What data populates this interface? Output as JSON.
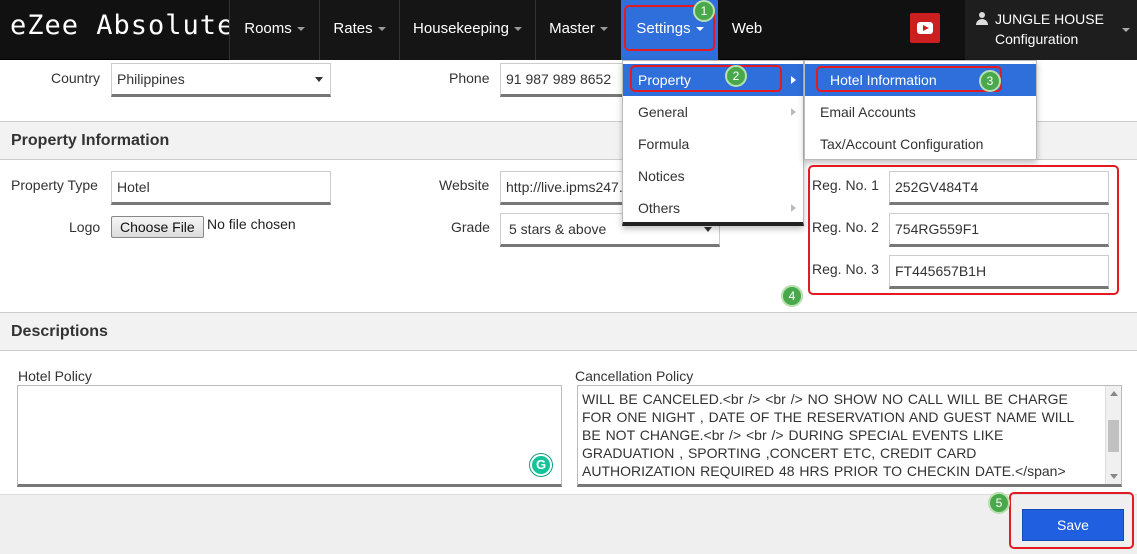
{
  "app": {
    "brand": "eZee Absolute"
  },
  "nav": {
    "rooms": "Rooms",
    "rates": "Rates",
    "housekeeping": "Housekeeping",
    "master": "Master",
    "settings": "Settings",
    "web": "Web",
    "video_icon": "youtube-icon",
    "user": {
      "name": "JUNGLE HOUSE",
      "sub": "Configuration"
    }
  },
  "contact": {
    "country_label": "Country",
    "country_value": "Philippines",
    "phone_label": "Phone",
    "phone_value": "91 987 989 8652"
  },
  "property": {
    "section_title": "Property Information",
    "type_label": "Property Type",
    "type_value": "Hotel",
    "logo_label": "Logo",
    "logo_button": "Choose File",
    "logo_status": "No file chosen",
    "website_label": "Website",
    "website_value": "http://live.ipms247.",
    "grade_label": "Grade",
    "grade_value": "5 stars & above",
    "reg1_label": "Reg. No. 1",
    "reg1_value": "252GV484T4",
    "reg2_label": "Reg. No. 2",
    "reg2_value": "754RG559F1",
    "reg3_label": "Reg. No. 3",
    "reg3_value": "FT445657B1H"
  },
  "descriptions": {
    "section_title": "Descriptions",
    "hotel_policy_label": "Hotel Policy",
    "hotel_policy_value": "",
    "cancellation_label": "Cancellation Policy",
    "cancellation_value": "WILL BE CANCELED.<br /> <br /> NO SHOW NO CALL WILL BE CHARGE FOR ONE NIGHT , DATE OF THE RESERVATION AND GUEST NAME WILL BE NOT CHANGE.<br /> <br /> DURING SPECIAL EVENTS LIKE GRADUATION , SPORTING ,CONCERT  ETC,  CREDIT CARD AUTHORIZATION REQUIRED 48 HRS PRIOR TO CHECKIN DATE.</span>",
    "grammarly_glyph": "G"
  },
  "actions": {
    "save": "Save"
  },
  "settings_menu": {
    "items": [
      "Property",
      "General",
      "Formula",
      "Notices",
      "Others"
    ]
  },
  "property_submenu": {
    "items": [
      "Hotel Information",
      "Email Accounts",
      "Tax/Account Configuration"
    ]
  },
  "annotations": {
    "step1": "1",
    "step2": "2",
    "step3": "3",
    "step4": "4",
    "step5": "5"
  },
  "colors": {
    "accent": "#2f6fdb",
    "annotation_red": "#e21b23",
    "badge_green": "#49a94a",
    "save_blue": "#1f5fe0"
  }
}
